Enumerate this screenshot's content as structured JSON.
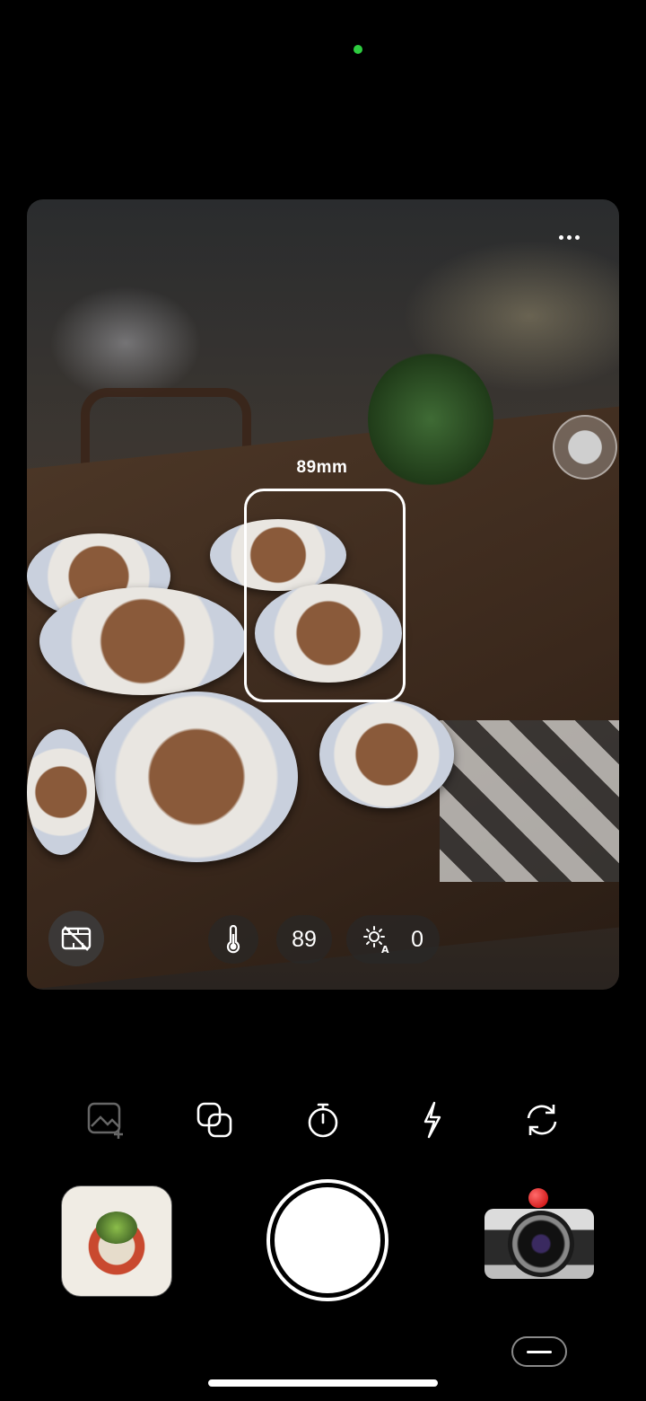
{
  "viewfinder": {
    "zoom_label": "89mm",
    "iso_value": "89",
    "exposure_value": "0"
  },
  "icons": {
    "more": "more-horizontal-icon",
    "focus_knob": "focus-knob",
    "no_video": "video-off-icon",
    "temperature": "thermometer-icon",
    "exposure": "sun-auto-icon",
    "add_photo": "image-add-icon",
    "overlay": "overlap-squares-icon",
    "timer": "timer-icon",
    "flash": "flash-icon",
    "flip": "rotate-camera-icon",
    "menu": "minus-icon"
  },
  "colors": {
    "status_dot": "#2ecc40",
    "background": "#000000",
    "camera_indicator": "#c40000"
  }
}
